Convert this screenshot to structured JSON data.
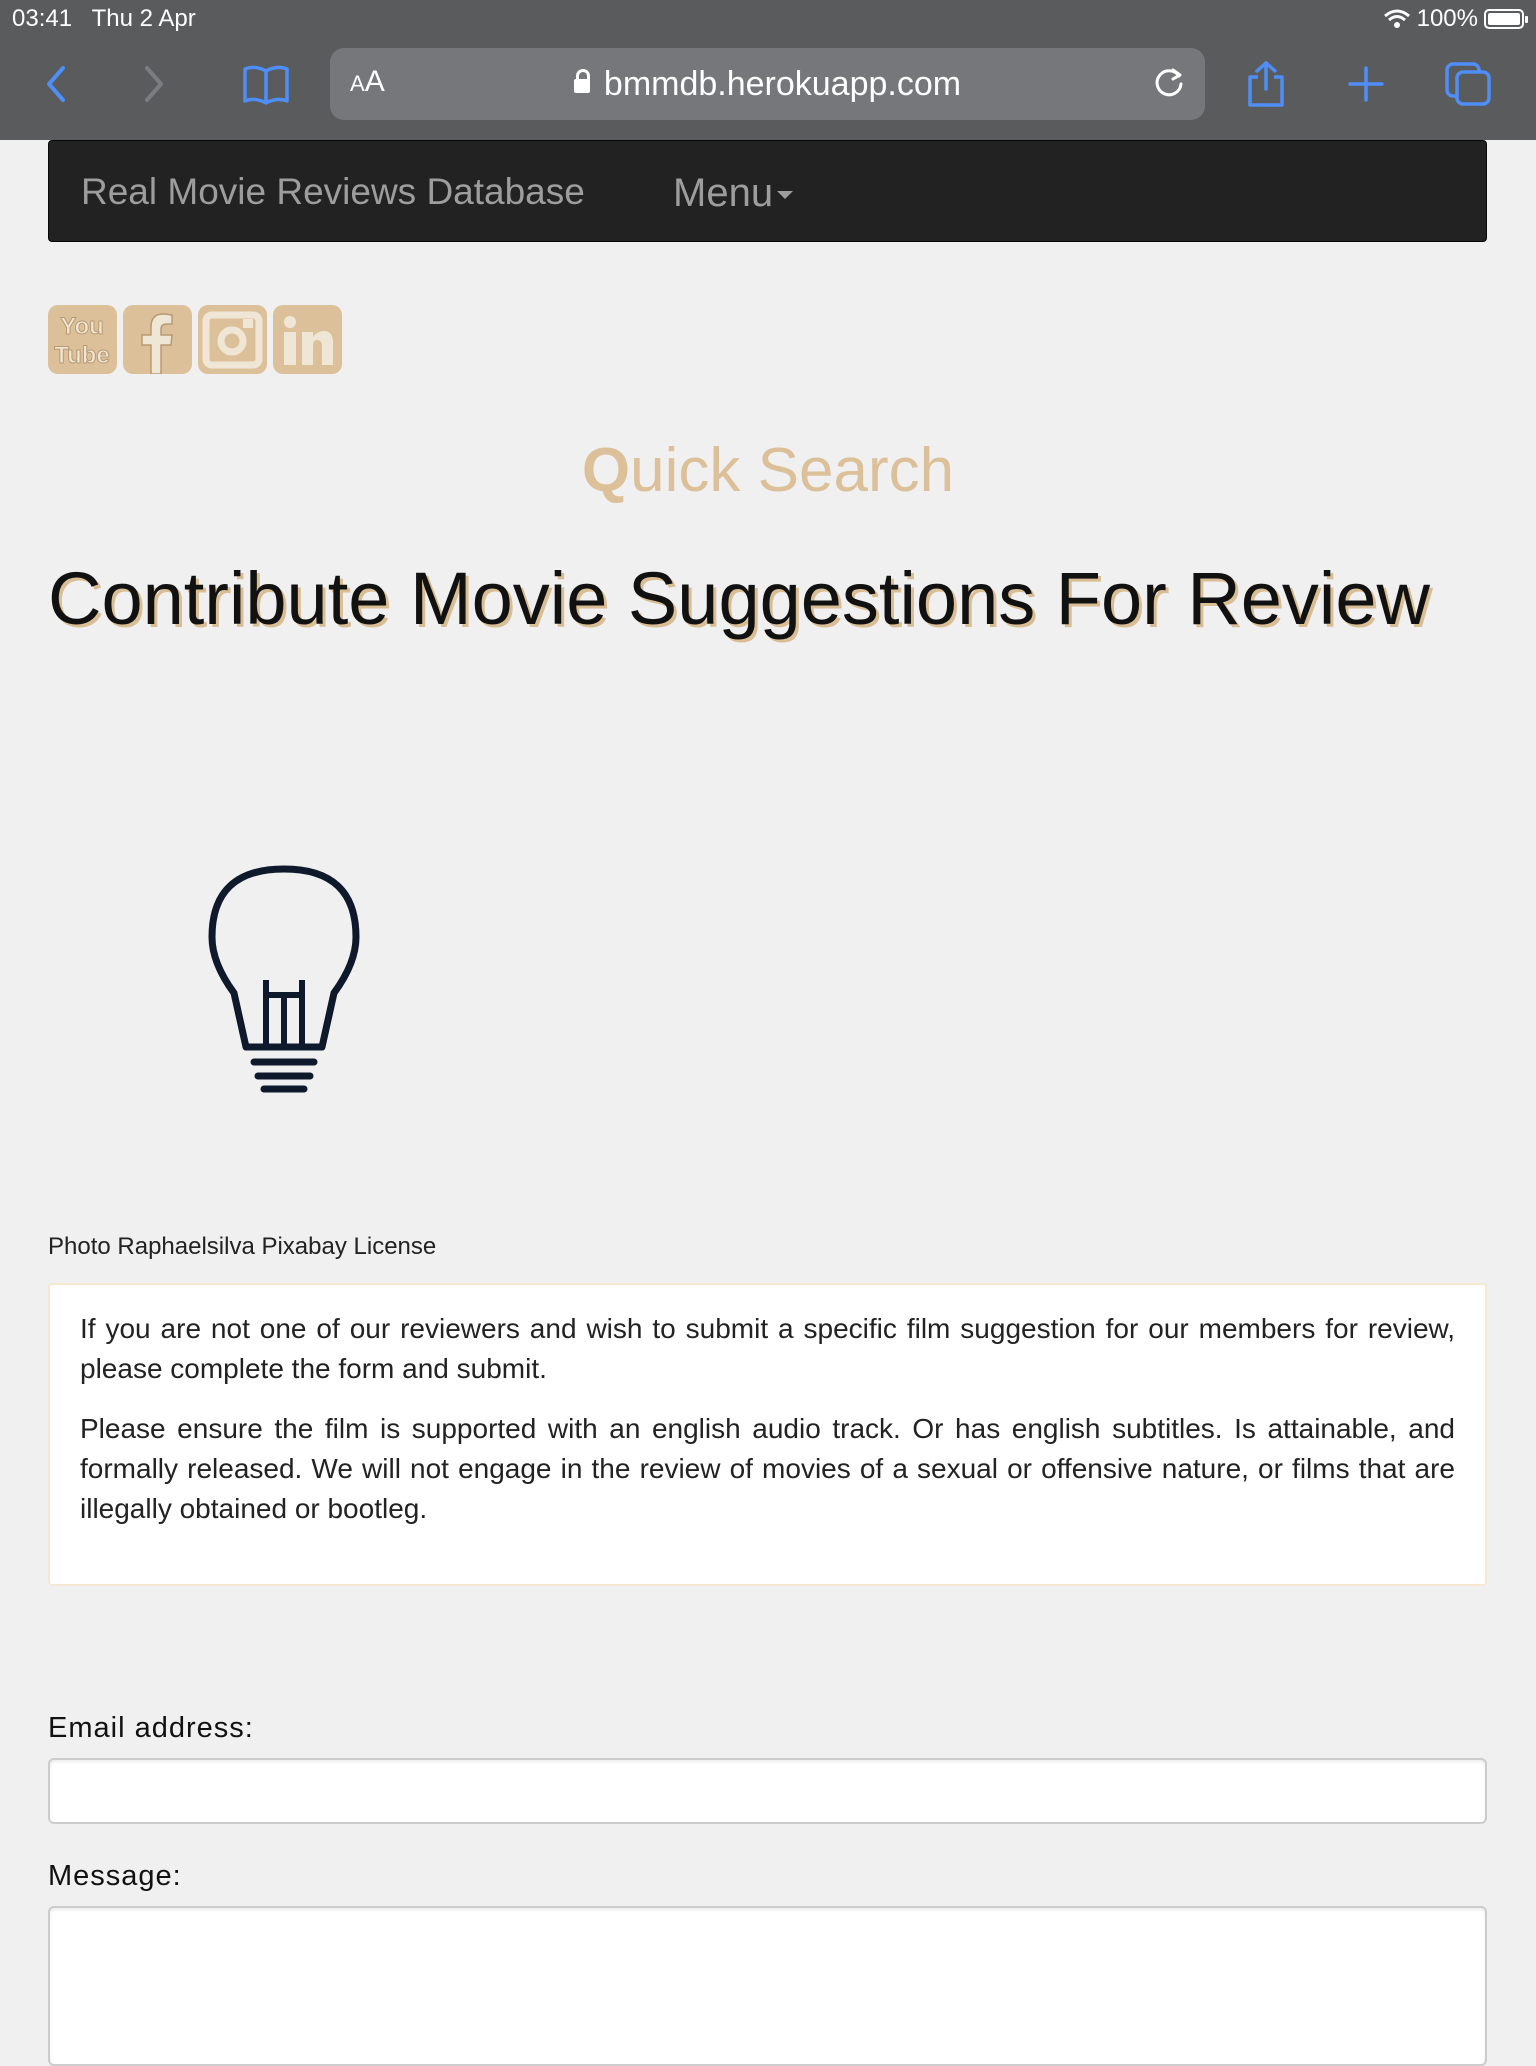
{
  "status": {
    "time": "03:41",
    "date": "Thu 2 Apr",
    "battery": "100%"
  },
  "browser": {
    "aa": "AA",
    "url": "bmmdb.herokuapp.com",
    "icons": [
      "back-icon",
      "forward-icon",
      "bookmarks-icon",
      "reload-icon",
      "share-icon",
      "new-tab-icon",
      "tabs-icon"
    ]
  },
  "nav": {
    "brand": "Real Movie Reviews Database",
    "menu": "Menu"
  },
  "social": [
    "youtube-icon",
    "facebook-icon",
    "instagram-icon",
    "linkedin-icon"
  ],
  "quick_search": {
    "q": "Q",
    "rest": "uick Search"
  },
  "headline": "Contribute Movie Suggestions For Review",
  "caption": "Photo Raphaelsilva Pixabay License",
  "info": {
    "p1": "If you are not one of our reviewers and wish to submit a specific film suggestion for our members for review, please complete the form and submit.",
    "p2": "Please ensure the film is supported with an english audio track. Or has english subtitles. Is attainable, and formally released. We will not engage in the review of movies of a sexual or offensive nature, or films that are illegally obtained or bootleg."
  },
  "form": {
    "email_label": "Email address:",
    "email_value": "",
    "message_label": "Message:",
    "message_value": ""
  },
  "colors": {
    "accent": "#dcc09a",
    "navbar": "#222222",
    "ios_blue": "#4f8ef7"
  }
}
